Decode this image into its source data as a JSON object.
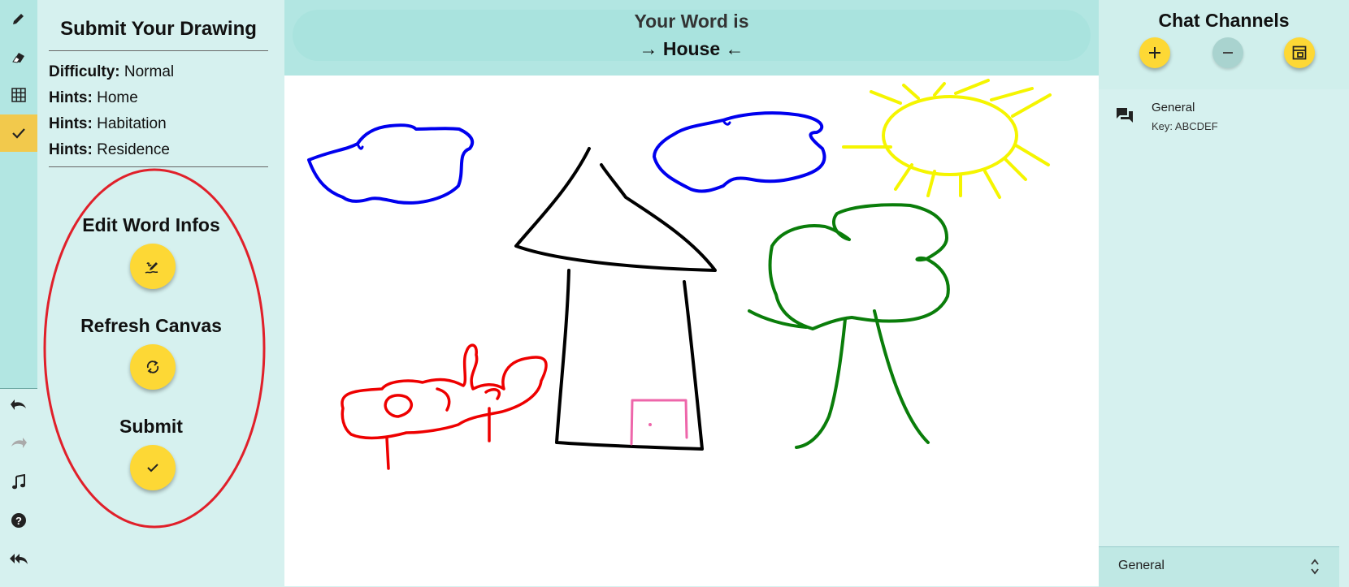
{
  "rail": {
    "tools": [
      {
        "name": "pencil-tool",
        "icon": "pencil-icon",
        "active": false
      },
      {
        "name": "eraser-tool",
        "icon": "eraser-icon",
        "active": false
      },
      {
        "name": "grid-tool",
        "icon": "grid-icon",
        "active": false
      },
      {
        "name": "submit-tool",
        "icon": "check-icon",
        "active": true
      }
    ],
    "bottom": [
      "undo-icon",
      "redo-icon",
      "music-note-icon",
      "help-icon",
      "reply-all-icon"
    ]
  },
  "panel": {
    "title": "Submit Your Drawing",
    "difficulty_label": "Difficulty:",
    "difficulty_value": "Normal",
    "hints_label": "Hints:",
    "hints": [
      "Home",
      "Habitation",
      "Residence"
    ],
    "edit_label": "Edit Word Infos",
    "refresh_label": "Refresh Canvas",
    "submit_label": "Submit"
  },
  "word": {
    "line1": "Your Word is",
    "line2": "→ House ←"
  },
  "chat": {
    "title": "Chat Channels",
    "channel_name": "General",
    "channel_key": "Key: ABCDEF",
    "selected_channel": "General"
  },
  "colors": {
    "accent": "#fdd835",
    "active_tool": "#f2c94c",
    "background": "#d6f1ef",
    "highlight": "#e0202a",
    "stroke_blue": "#0000ee",
    "stroke_yellow": "#f5f500",
    "stroke_green": "#0a7d0a",
    "stroke_red": "#ee0000",
    "stroke_black": "#000000",
    "stroke_pink": "#ee66aa"
  }
}
